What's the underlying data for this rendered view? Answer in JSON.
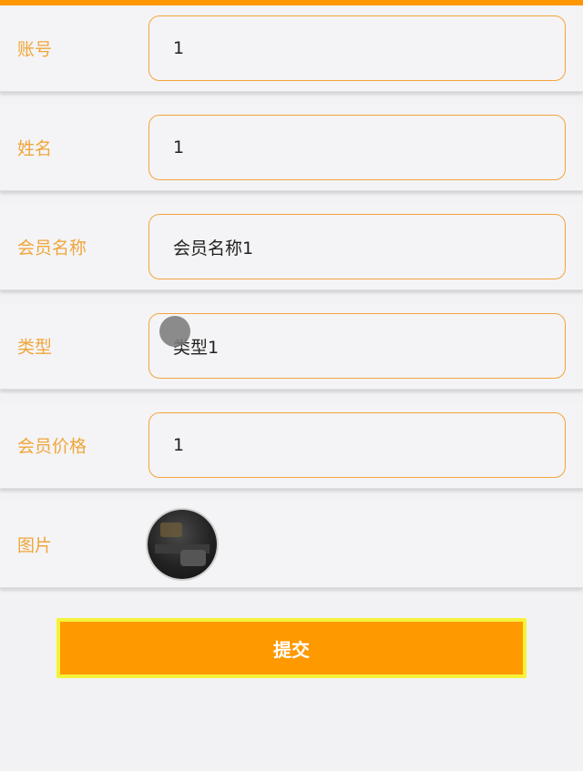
{
  "form": {
    "fields": [
      {
        "label": "账号",
        "value": "1"
      },
      {
        "label": "姓名",
        "value": "1"
      },
      {
        "label": "会员名称",
        "value": "会员名称1"
      },
      {
        "label": "类型",
        "value": "类型1"
      },
      {
        "label": "会员价格",
        "value": "1"
      }
    ],
    "image_label": "图片",
    "submit_label": "提交"
  },
  "colors": {
    "accent": "#ff9800",
    "label": "#f0a63a",
    "submit_border": "#f4f33a"
  }
}
